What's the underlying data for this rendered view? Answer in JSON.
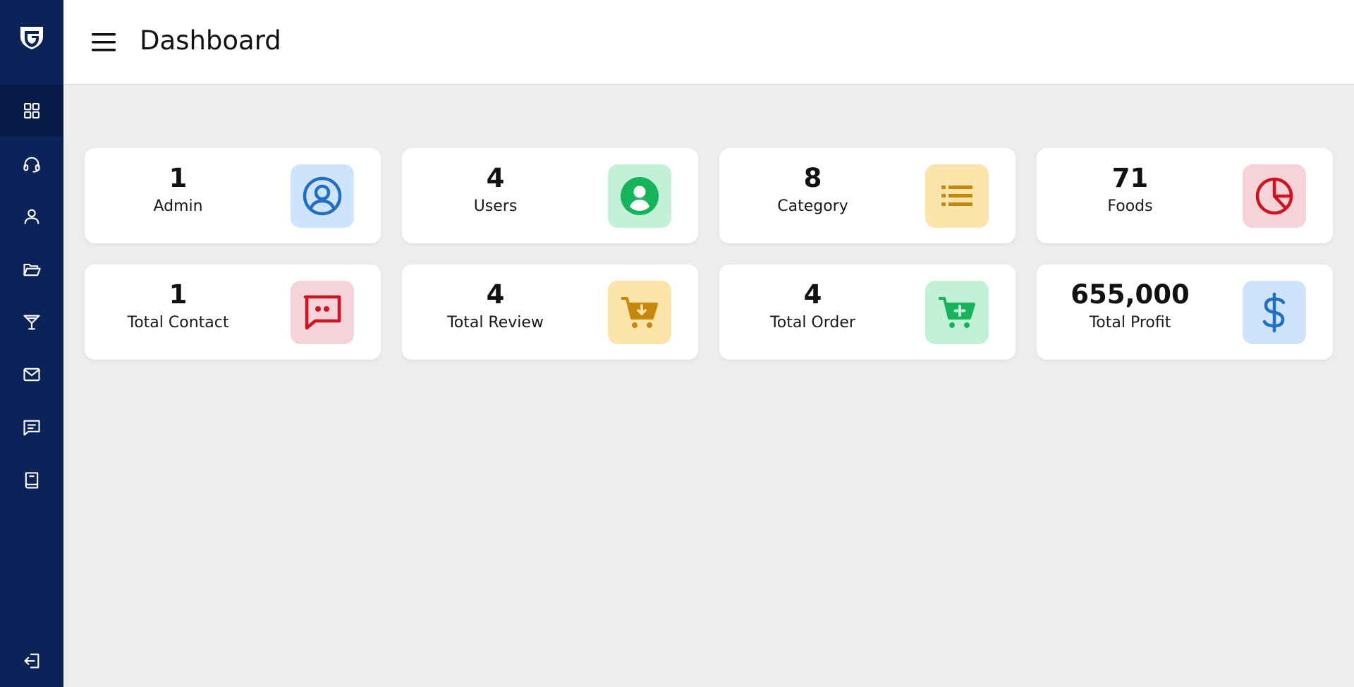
{
  "page": {
    "title": "Dashboard"
  },
  "sidebar": {
    "items": [
      {
        "icon": "grid-icon",
        "name": "dashboard",
        "active": true
      },
      {
        "icon": "headset-icon",
        "name": "support"
      },
      {
        "icon": "user-icon",
        "name": "users"
      },
      {
        "icon": "folder-open-icon",
        "name": "categories"
      },
      {
        "icon": "cocktail-icon",
        "name": "foods"
      },
      {
        "icon": "mail-icon",
        "name": "contacts"
      },
      {
        "icon": "message-icon",
        "name": "reviews"
      },
      {
        "icon": "book-icon",
        "name": "orders"
      }
    ],
    "logout": {
      "icon": "logout-icon"
    }
  },
  "cards": [
    {
      "value": "1",
      "label": "Admin",
      "icon": "user-circle-icon",
      "icon_bg": "#cfe4fb",
      "icon_color": "#1f6fc5"
    },
    {
      "value": "4",
      "label": "Users",
      "icon": "user-solid-circle-icon",
      "icon_bg": "#c3f1d6",
      "icon_color": "#16b35a"
    },
    {
      "value": "8",
      "label": "Category",
      "icon": "list-icon",
      "icon_bg": "#fde4ab",
      "icon_color": "#c7870a"
    },
    {
      "value": "71",
      "label": "Foods",
      "icon": "pie-chart-icon",
      "icon_bg": "#f5d3d8",
      "icon_color": "#d1121f"
    },
    {
      "value": "1",
      "label": "Total Contact",
      "icon": "chat-icon",
      "icon_bg": "#f5d3d8",
      "icon_color": "#d1121f"
    },
    {
      "value": "4",
      "label": "Total Review",
      "icon": "cart-download-icon",
      "icon_bg": "#fde4ab",
      "icon_color": "#c7870a"
    },
    {
      "value": "4",
      "label": "Total Order",
      "icon": "cart-plus-icon",
      "icon_bg": "#c3f1d6",
      "icon_color": "#16b35a"
    },
    {
      "value": "655,000",
      "label": "Total Profit",
      "icon": "dollar-icon",
      "icon_bg": "#cfe4fb",
      "icon_color": "#1f6fc5"
    }
  ],
  "colors": {
    "sidebar_bg": "#0c2359",
    "sidebar_active_bg": "#081a45",
    "page_bg": "#ededed"
  }
}
